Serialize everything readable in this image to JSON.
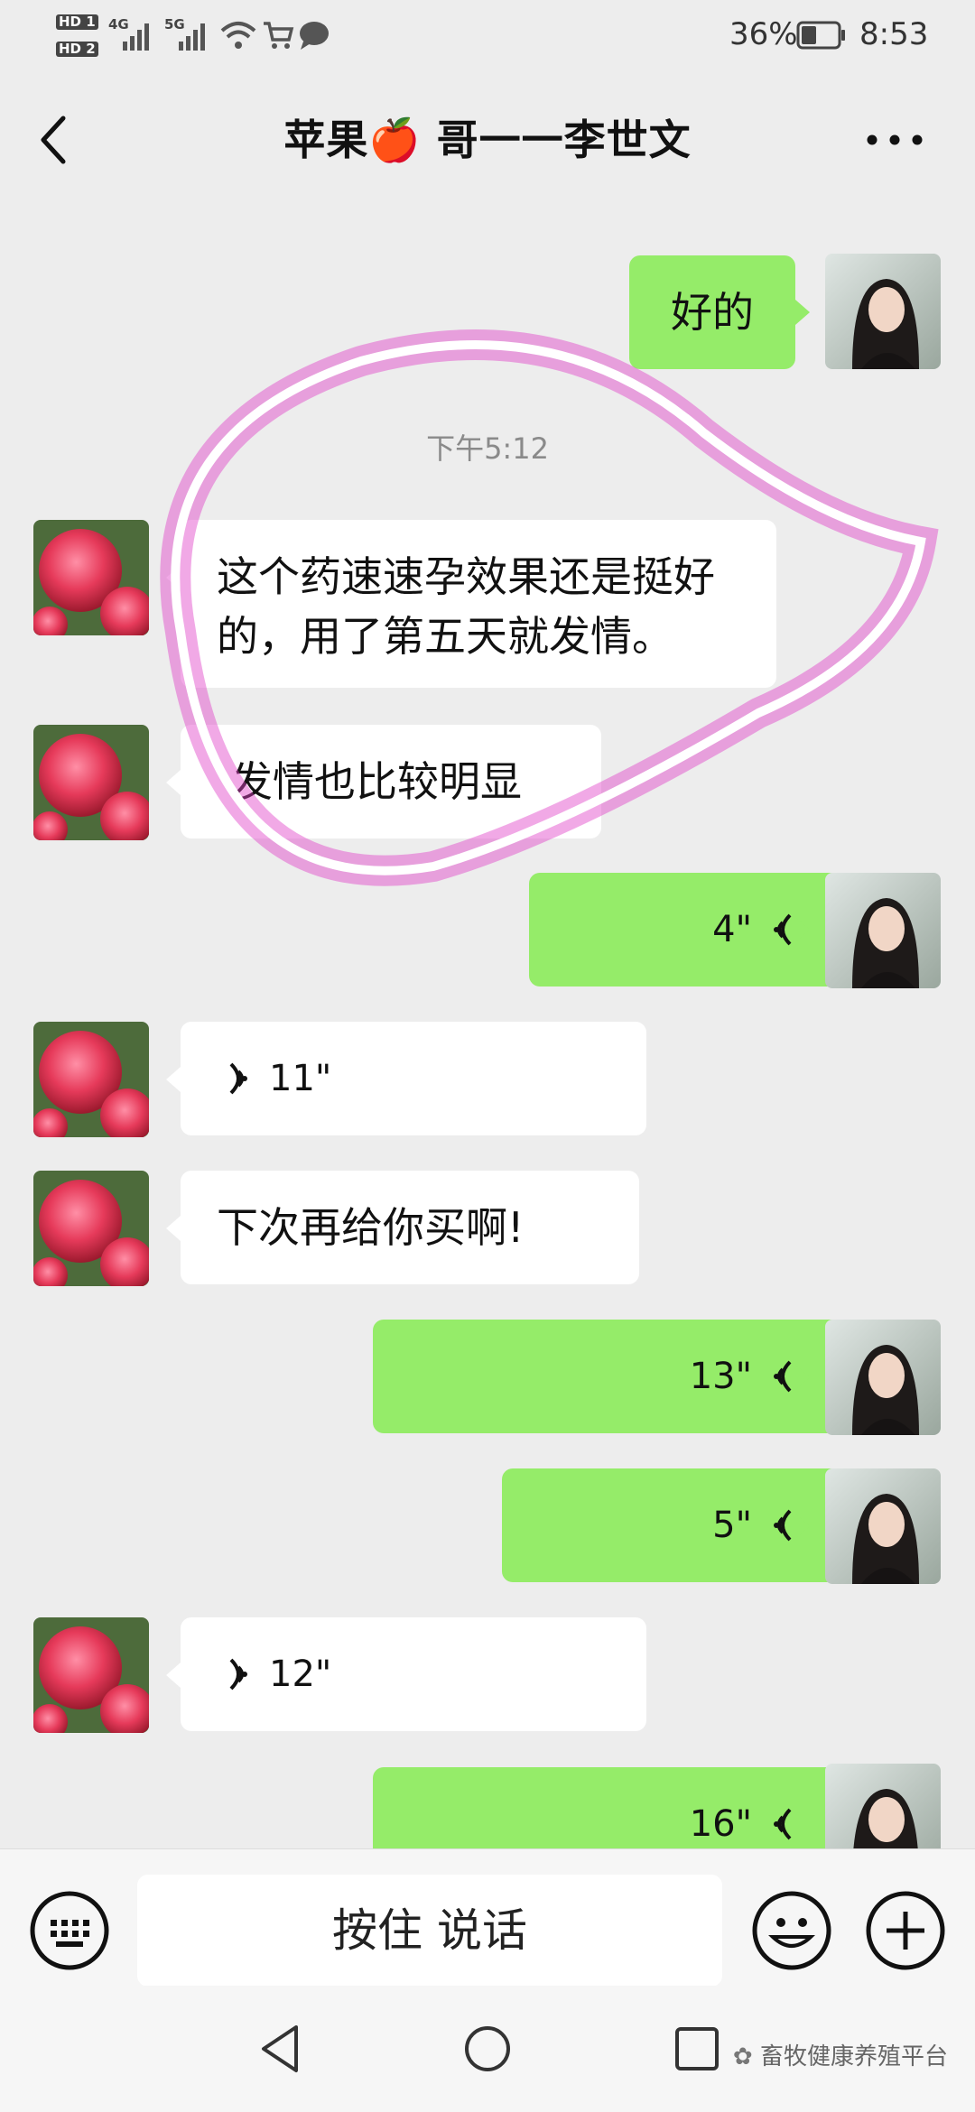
{
  "status_bar": {
    "hd1": "HD 1",
    "hd2": "HD 2",
    "net1": "4G",
    "net2": "5G",
    "battery": "36%",
    "time": "8:53"
  },
  "header": {
    "title": "苹果🍎 哥一一李世文"
  },
  "messages": [
    {
      "side": "out",
      "type": "text",
      "text": "好的"
    },
    {
      "type": "time",
      "text": "下午5:12"
    },
    {
      "side": "in",
      "type": "text",
      "text": "这个药速速孕效果还是挺好的，用了第五天就发情。"
    },
    {
      "side": "in",
      "type": "text",
      "text": "发情也比较明显"
    },
    {
      "side": "out",
      "type": "voice",
      "duration": "4\""
    },
    {
      "side": "in",
      "type": "voice",
      "duration": "11\""
    },
    {
      "side": "in",
      "type": "text",
      "text": "下次再给你买啊!"
    },
    {
      "side": "out",
      "type": "voice",
      "duration": "13\""
    },
    {
      "side": "out",
      "type": "voice",
      "duration": "5\""
    },
    {
      "side": "in",
      "type": "voice",
      "duration": "12\""
    },
    {
      "side": "out",
      "type": "voice",
      "duration": "16\""
    }
  ],
  "input_bar": {
    "hold_to_talk": "按住 说话"
  },
  "watermark": "畜牧健康养殖平台",
  "colors": {
    "background": "#ededed",
    "out_bubble": "#95ec69",
    "in_bubble": "#ffffff",
    "highlight": "#e040c8"
  }
}
